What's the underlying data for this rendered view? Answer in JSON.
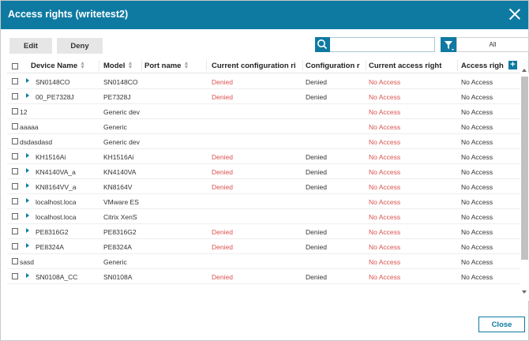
{
  "dialog": {
    "title": "Access rights (writetest2)"
  },
  "toolbar": {
    "edit_label": "Edit",
    "deny_label": "Deny"
  },
  "search": {
    "value": "",
    "placeholder": ""
  },
  "filter": {
    "selected": "All"
  },
  "table": {
    "headers": {
      "device_name": "Device Name",
      "model": "Model",
      "port_name": "Port name",
      "current_config_right": "Current configuration ri",
      "config_right": "Configuration r",
      "current_access_right": "Current access right",
      "access_right": "Access righ"
    },
    "rows": [
      {
        "expandable": true,
        "device": "SN0148CO",
        "model": "SN0148CO",
        "port": "",
        "cur_cfg": "Denied",
        "cfg": "Denied",
        "cur_acc": "No Access",
        "acc": "No Access"
      },
      {
        "expandable": true,
        "device": "00_PE7328J",
        "model": "PE7328J",
        "port": "",
        "cur_cfg": "Denied",
        "cfg": "Denied",
        "cur_acc": "No Access",
        "acc": "No Access"
      },
      {
        "expandable": false,
        "device": "12",
        "model": "Generic dev",
        "port": "",
        "cur_cfg": "",
        "cfg": "",
        "cur_acc": "No Access",
        "acc": "No Access"
      },
      {
        "expandable": false,
        "device": "aaaaa",
        "model": "Generic",
        "port": "",
        "cur_cfg": "",
        "cfg": "",
        "cur_acc": "No Access",
        "acc": "No Access"
      },
      {
        "expandable": false,
        "device": "dsdasdasd",
        "model": "Generic dev",
        "port": "",
        "cur_cfg": "",
        "cfg": "",
        "cur_acc": "No Access",
        "acc": "No Access"
      },
      {
        "expandable": true,
        "device": "KH1516Ai",
        "model": "KH1516Ai",
        "port": "",
        "cur_cfg": "Denied",
        "cfg": "Denied",
        "cur_acc": "No Access",
        "acc": "No Access"
      },
      {
        "expandable": true,
        "device": "KN4140VA_a",
        "model": "KN4140VA",
        "port": "",
        "cur_cfg": "Denied",
        "cfg": "Denied",
        "cur_acc": "No Access",
        "acc": "No Access"
      },
      {
        "expandable": true,
        "device": "KN8164VV_a",
        "model": "KN8164V",
        "port": "",
        "cur_cfg": "Denied",
        "cfg": "Denied",
        "cur_acc": "No Access",
        "acc": "No Access"
      },
      {
        "expandable": true,
        "device": "localhost.loca",
        "model": "VMware ES",
        "port": "",
        "cur_cfg": "",
        "cfg": "",
        "cur_acc": "No Access",
        "acc": "No Access"
      },
      {
        "expandable": true,
        "device": "localhost.loca",
        "model": "Citrix XenS",
        "port": "",
        "cur_cfg": "",
        "cfg": "",
        "cur_acc": "No Access",
        "acc": "No Access"
      },
      {
        "expandable": true,
        "device": "PE8316G2",
        "model": "PE8316G2",
        "port": "",
        "cur_cfg": "Denied",
        "cfg": "Denied",
        "cur_acc": "No Access",
        "acc": "No Access"
      },
      {
        "expandable": true,
        "device": "PE8324A",
        "model": "PE8324A",
        "port": "",
        "cur_cfg": "Denied",
        "cfg": "Denied",
        "cur_acc": "No Access",
        "acc": "No Access"
      },
      {
        "expandable": false,
        "device": "sasd",
        "model": "Generic",
        "port": "",
        "cur_cfg": "",
        "cfg": "",
        "cur_acc": "No Access",
        "acc": "No Access"
      },
      {
        "expandable": true,
        "device": "SN0108A_CC",
        "model": "SN0108A",
        "port": "",
        "cur_cfg": "Denied",
        "cfg": "Denied",
        "cur_acc": "No Access",
        "acc": "No Access"
      }
    ]
  },
  "footer": {
    "close_label": "Close"
  },
  "colors": {
    "accent": "#0e7aa2",
    "denied": "#d9534f"
  }
}
